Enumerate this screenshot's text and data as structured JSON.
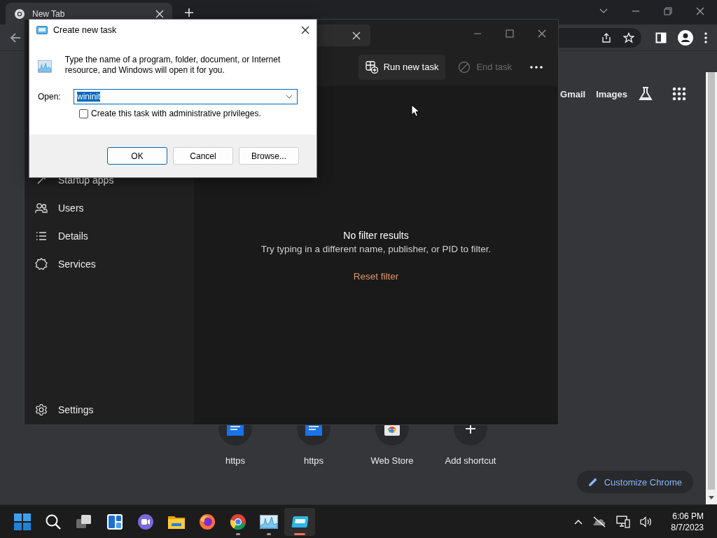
{
  "browser": {
    "tab": {
      "title": "New Tab",
      "selected": true
    },
    "links": [
      "Gmail",
      "Images"
    ],
    "shortcuts": [
      {
        "label": "https",
        "kind": "gif"
      },
      {
        "label": "https",
        "kind": "gif"
      },
      {
        "label": "Web Store",
        "kind": "store"
      },
      {
        "label": "Add shortcut",
        "kind": "add"
      }
    ],
    "customize_button": "Customize Chrome"
  },
  "task_manager": {
    "toolbar": [
      {
        "label": "Run new task",
        "kind": "run",
        "disabled": false
      },
      {
        "label": "End task",
        "kind": "end",
        "disabled": true
      }
    ],
    "nav_items": [
      {
        "label": "Startup apps",
        "kind": "startup"
      },
      {
        "label": "Users",
        "kind": "users"
      },
      {
        "label": "Details",
        "kind": "details"
      },
      {
        "label": "Services",
        "kind": "services"
      }
    ],
    "settings": "Settings",
    "empty_state": {
      "title": "No filter results",
      "message": "Try typing in a different name, publisher, or PID to filter.",
      "action": "Reset filter"
    }
  },
  "dialog": {
    "title": "Create new task",
    "description": "Type the name of a program, folder, document, or Internet resource, and Windows will open it for you.",
    "open_label": "Open:",
    "open_value": "wininit",
    "admin_checkbox": {
      "label": "Create this task with administrative privileges.",
      "checked": false
    },
    "buttons": [
      {
        "label": "OK",
        "default": true
      },
      {
        "label": "Cancel",
        "default": false
      },
      {
        "label": "Browse...",
        "default": false
      }
    ]
  },
  "taskbar": {
    "apps": [
      {
        "kind": "start",
        "running": false,
        "active": false
      },
      {
        "kind": "search",
        "running": false,
        "active": false
      },
      {
        "kind": "taskview",
        "running": false,
        "active": false
      },
      {
        "kind": "widgets",
        "running": false,
        "active": false
      },
      {
        "kind": "chat",
        "running": false,
        "active": false
      },
      {
        "kind": "explorer",
        "running": false,
        "active": false
      },
      {
        "kind": "firefox",
        "running": false,
        "active": false
      },
      {
        "kind": "browser",
        "running": true,
        "active": false
      },
      {
        "kind": "monitor",
        "running": true,
        "active": false
      },
      {
        "kind": "run",
        "running": true,
        "active": true
      }
    ],
    "time": "6:06 PM",
    "date": "8/7/2023"
  }
}
